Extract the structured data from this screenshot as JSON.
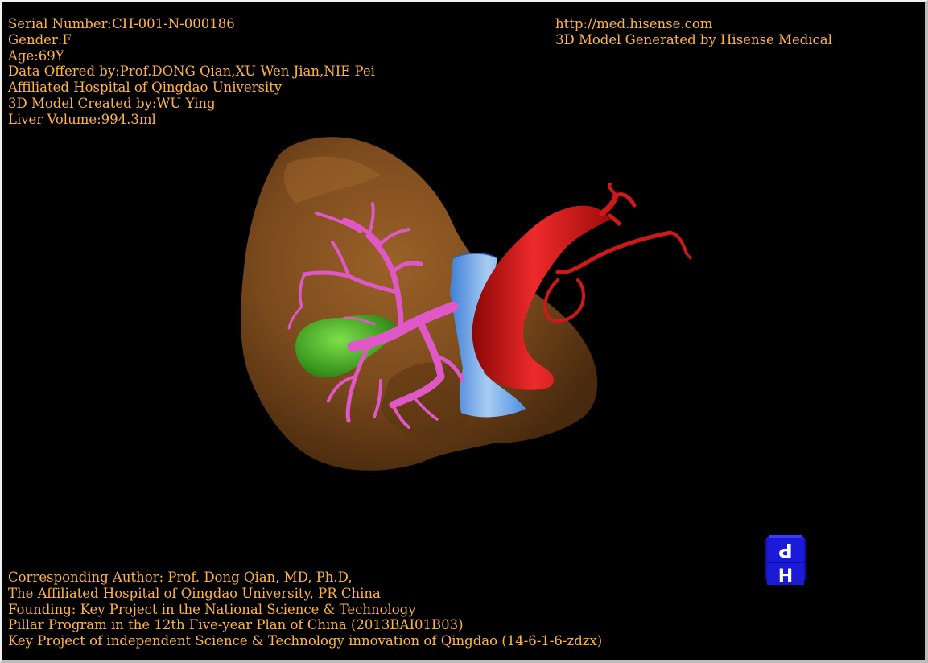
{
  "patient_info": [
    "Serial Number:CH-001-N-000186",
    "Gender:F",
    "Age:69Y",
    "Data Offered by:Prof.DONG Qian,XU Wen Jian,NIE Pei",
    "Affiliated Hospital of Qingdao University",
    "3D Model Created by:WU Ying",
    "Liver Volume:994.3ml"
  ],
  "generator_info": [
    "http://med.hisense.com",
    "3D Model Generated by Hisense Medical"
  ],
  "credits": [
    "Corresponding Author: Prof. Dong Qian, MD, Ph.D,",
    "The Affiliated Hospital of Qingdao University, PR China",
    "Founding: Key Project in the National Science & Technology",
    "Pillar Program in the 12th Five-year Plan of China (2013BAI01B03)",
    "Key Project of independent Science & Technology innovation of Qingdao (14-6-1-6-zdzx)"
  ],
  "orientation_cube": {
    "top_face_label": "P",
    "front_face_label": "H"
  },
  "colors": {
    "background": "#000000",
    "overlay_text": "#ffb347",
    "liver": "#7a4a1c",
    "portal_vein": "#e058c8",
    "gallbladder": "#4fb52a",
    "vena_cava": "#5b9be8",
    "aorta": "#d01818",
    "cube": "#1a1ad8"
  },
  "icons": {
    "model": "3d-liver-model",
    "cube": "orientation-cube-icon"
  }
}
